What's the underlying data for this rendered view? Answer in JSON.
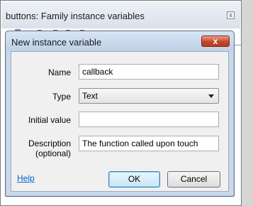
{
  "background_window": {
    "title": "buttons: Family instance variables",
    "close_glyph": "x"
  },
  "dialog": {
    "title": "New instance variable",
    "close_glyph": "x",
    "fields": {
      "name": {
        "label": "Name",
        "value": "callback"
      },
      "type": {
        "label": "Type",
        "value": "Text"
      },
      "initial_value": {
        "label": "Initial value",
        "value": ""
      },
      "description": {
        "label_line1": "Description",
        "label_line2": "(optional)",
        "value": "The function called upon touch"
      }
    },
    "help_label": "Help",
    "ok_label": "OK",
    "cancel_label": "Cancel"
  },
  "icons": {
    "close": "close-icon",
    "dropdown": "chevron-down-icon"
  },
  "colors": {
    "close_button": "#c7462a",
    "link": "#0066cc",
    "default_button_border": "#3c7fb1"
  }
}
